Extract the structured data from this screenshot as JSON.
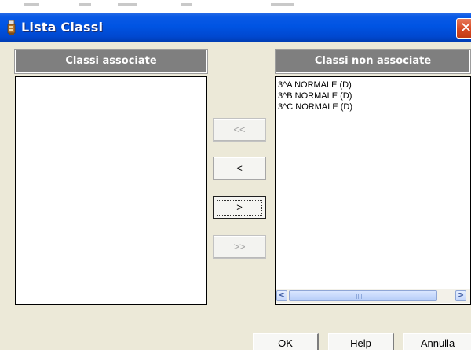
{
  "window": {
    "title": "Lista Classi",
    "close_glyph": "✕"
  },
  "associated": {
    "header": "Classi associate",
    "items": []
  },
  "not_associated": {
    "header": "Classi non associate",
    "items": [
      "3^A NORMALE (D)",
      "3^B NORMALE (D)",
      "3^C NORMALE (D)"
    ]
  },
  "scrollbar": {
    "left_arrow": "<",
    "right_arrow": ">"
  },
  "move_buttons": {
    "move_all_left": "<<",
    "move_left": "<",
    "move_right": ">",
    "move_all_right": ">>"
  },
  "footer": {
    "ok": "OK",
    "help": "Help",
    "cancel": "Annulla"
  },
  "icons": [
    "app-icon",
    "close-icon",
    "scroll-left-icon",
    "scroll-right-icon"
  ]
}
